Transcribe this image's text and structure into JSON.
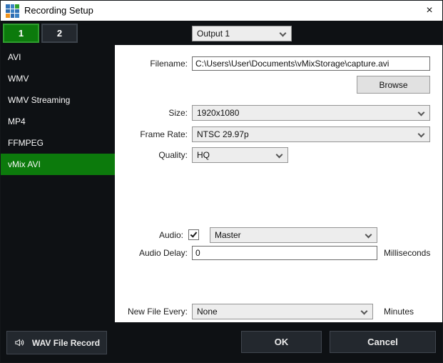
{
  "window": {
    "title": "Recording Setup",
    "close_glyph": "×",
    "app_icon_colors": [
      "#3273b8",
      "#3b82c4",
      "#2fa32f",
      "#2f6cb0",
      "#3b82c4",
      "#3273b8",
      "#f0941e",
      "#2f6cb0",
      "#3b82c4"
    ]
  },
  "colors": {
    "accent_green": "#0c7a0c",
    "titlebar_bg": "#ffffff",
    "body_bg": "#0e1114",
    "panel_bg": "#ffffff"
  },
  "tabs": [
    {
      "label": "1",
      "selected": true
    },
    {
      "label": "2",
      "selected": false
    }
  ],
  "output_selector": {
    "value": "Output 1"
  },
  "sidebar": {
    "items": [
      {
        "label": "AVI",
        "selected": false
      },
      {
        "label": "WMV",
        "selected": false
      },
      {
        "label": "WMV Streaming",
        "selected": false
      },
      {
        "label": "MP4",
        "selected": false
      },
      {
        "label": "FFMPEG",
        "selected": false
      },
      {
        "label": "vMix AVI",
        "selected": true
      }
    ]
  },
  "form": {
    "filename": {
      "label": "Filename:",
      "value": "C:\\Users\\User\\Documents\\vMixStorage\\capture.avi"
    },
    "browse_label": "Browse",
    "size": {
      "label": "Size:",
      "value": "1920x1080"
    },
    "frame_rate": {
      "label": "Frame Rate:",
      "value": "NTSC 29.97p"
    },
    "quality": {
      "label": "Quality:",
      "value": "HQ"
    },
    "audio": {
      "label": "Audio:",
      "checked": true,
      "value": "Master"
    },
    "audio_delay": {
      "label": "Audio Delay:",
      "value": "0",
      "unit": "Milliseconds"
    },
    "new_file_every": {
      "label": "New File Every:",
      "value": "None",
      "unit": "Minutes"
    }
  },
  "footer": {
    "wav_button_label": "WAV File Record",
    "ok_label": "OK",
    "cancel_label": "Cancel"
  }
}
